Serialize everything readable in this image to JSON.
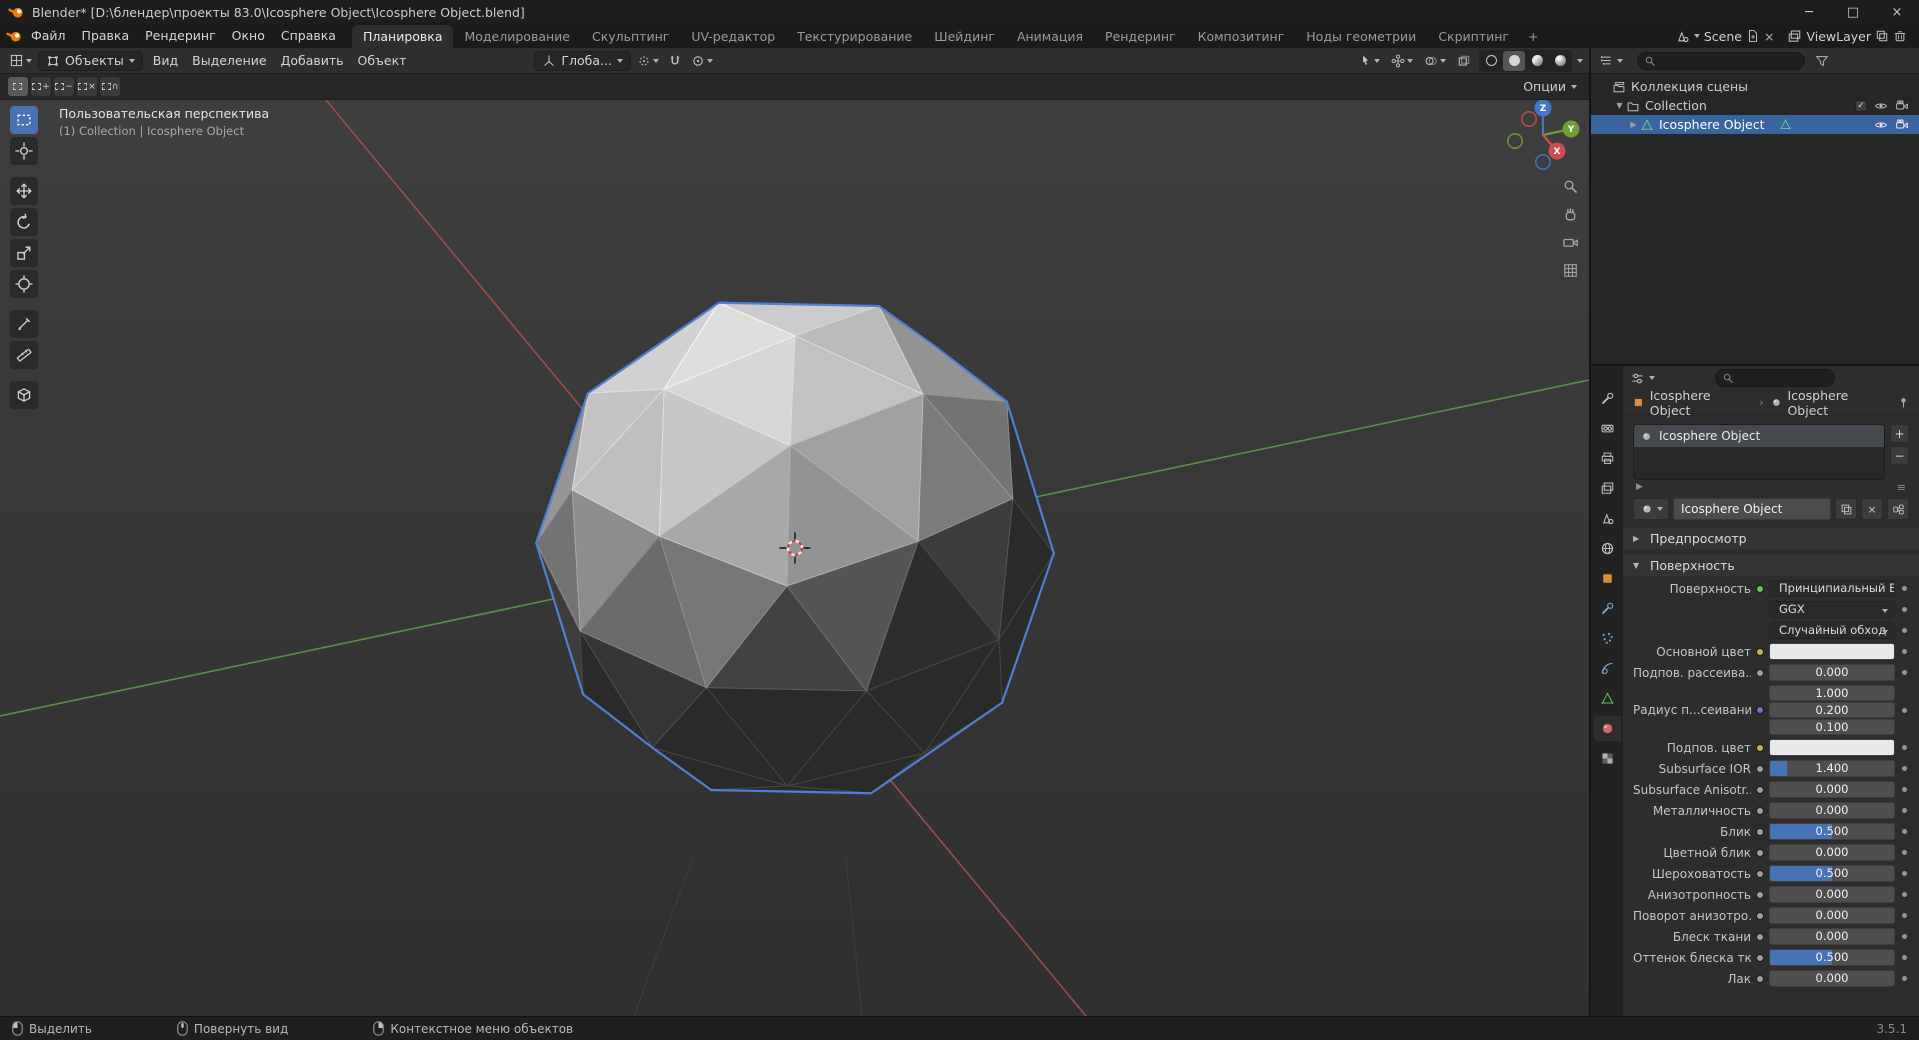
{
  "window": {
    "title": "Blender* [D:\\блендер\\проекты 83.0\\Icosphere Object\\Icosphere Object.blend]",
    "controls": {
      "minimize": "─",
      "maximize": "□",
      "close": "×"
    }
  },
  "topbar": {
    "menus": [
      "Файл",
      "Правка",
      "Рендеринг",
      "Окно",
      "Справка"
    ],
    "tabs": [
      "Планировка",
      "Моделирование",
      "Скульптинг",
      "UV-редактор",
      "Текстурирование",
      "Шейдинг",
      "Анимация",
      "Рендеринг",
      "Композитинг",
      "Ноды геометрии",
      "Скриптинг"
    ],
    "active_tab": "Планировка",
    "add_tab": "+",
    "scene": {
      "label": "Scene"
    },
    "view_layer": {
      "label": "ViewLayer"
    }
  },
  "viewport": {
    "header": {
      "mode": "Объекты",
      "menus": [
        "Вид",
        "Выделение",
        "Добавить",
        "Объект"
      ],
      "orientation": "Глоба...",
      "options": "Опции"
    },
    "overlay": {
      "line1": "Пользовательская перспектива",
      "line2": "(1) Collection | Icosphere Object"
    },
    "gizmo": {
      "x": "X",
      "y": "Y",
      "z": "Z"
    },
    "tools": [
      "box-select",
      "cursor",
      "move",
      "rotate",
      "scale",
      "transform",
      "annotate",
      "measure",
      "add-cube"
    ]
  },
  "outliner": {
    "rows": [
      {
        "label": "Коллекция сцены",
        "icon": "scene-collection",
        "indent": 0,
        "disclosure": "",
        "controls": []
      },
      {
        "label": "Collection",
        "icon": "collection",
        "indent": 1,
        "disclosure": "▼",
        "controls": [
          "checkbox",
          "eye",
          "camera"
        ],
        "checkbox_checked": true
      },
      {
        "label": "Icosphere Object",
        "icon": "mesh",
        "indent": 2,
        "disclosure": "▶",
        "selected": true,
        "badge": "mesh",
        "controls": [
          "eye",
          "camera"
        ]
      }
    ]
  },
  "properties": {
    "breadcrumb": [
      {
        "icon": "object",
        "label": "Icosphere Object"
      },
      {
        "icon": "material",
        "label": "Icosphere Object"
      }
    ],
    "slot": {
      "name": "Icosphere Object"
    },
    "datablock": {
      "name": "Icosphere Object"
    },
    "sections": {
      "preview": "Предпросмотр",
      "surface": "Поверхность"
    },
    "surface": {
      "shader_label": "Поверхность",
      "shader": "Принципиальный BSDF",
      "shader_socket": "#63c763",
      "distribution": "GGX",
      "method": "Случайный обход",
      "rows": [
        {
          "label": "Основной цвет",
          "type": "color",
          "socket": "#c9b040"
        },
        {
          "label": "Подпов. рассеива...",
          "type": "slider",
          "value": "0.000",
          "fill": 0,
          "socket": "#a0a0a0"
        },
        {
          "label": "Радиус п...сеивания",
          "type": "vector",
          "values": [
            "1.000",
            "0.200",
            "0.100"
          ],
          "socket": "#7070c8"
        },
        {
          "label": "Подпов. цвет",
          "type": "color",
          "socket": "#c9b040"
        },
        {
          "label": "Subsurface IOR",
          "type": "slider",
          "value": "1.400",
          "fill": 0.14,
          "socket": "#a0a0a0"
        },
        {
          "label": "Subsurface Anisotr...",
          "type": "slider",
          "value": "0.000",
          "fill": 0,
          "socket": "#a0a0a0"
        },
        {
          "label": "Металличность",
          "type": "slider",
          "value": "0.000",
          "fill": 0,
          "socket": "#a0a0a0"
        },
        {
          "label": "Блик",
          "type": "slider",
          "value": "0.500",
          "fill": 0.5,
          "socket": "#a0a0a0"
        },
        {
          "label": "Цветной блик",
          "type": "slider",
          "value": "0.000",
          "fill": 0,
          "socket": "#a0a0a0"
        },
        {
          "label": "Шероховатость",
          "type": "slider",
          "value": "0.500",
          "fill": 0.5,
          "socket": "#a0a0a0"
        },
        {
          "label": "Анизотропность",
          "type": "slider",
          "value": "0.000",
          "fill": 0,
          "socket": "#a0a0a0"
        },
        {
          "label": "Поворот анизотро...",
          "type": "slider",
          "value": "0.000",
          "fill": 0,
          "socket": "#a0a0a0"
        },
        {
          "label": "Блеск ткани",
          "type": "slider",
          "value": "0.000",
          "fill": 0,
          "socket": "#a0a0a0"
        },
        {
          "label": "Оттенок блеска тк...",
          "type": "slider",
          "value": "0.500",
          "fill": 0.5,
          "socket": "#a0a0a0"
        },
        {
          "label": "Лак",
          "type": "slider",
          "value": "0.000",
          "fill": 0,
          "socket": "#a0a0a0"
        }
      ]
    }
  },
  "status_bar": {
    "items": [
      {
        "icon": "mouse-left",
        "label": "Выделить"
      },
      {
        "icon": "mouse-middle",
        "label": "Повернуть вид"
      },
      {
        "icon": "mouse-right",
        "label": "Контекстное меню объектов"
      }
    ],
    "version": "3.5.1"
  },
  "colors": {
    "accent": "#4772b3",
    "selection_outline": "#4f7fd6",
    "axis_x": "#a8504f",
    "axis_y": "#5d9b4a",
    "gizmo_x": "#cc4d4d",
    "gizmo_y": "#6f9e33",
    "gizmo_z": "#4178c8",
    "object_icon": "#dd8d3f",
    "mesh_icon": "#6fc98a",
    "material_icon": "#c96c5c"
  }
}
